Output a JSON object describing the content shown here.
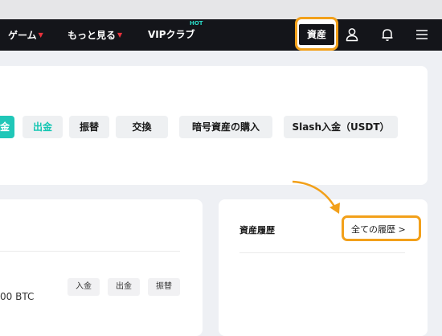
{
  "nav": {
    "games": "ゲーム",
    "more": "もっと見る",
    "vip": "VIPクラブ",
    "hot_badge": "HOT",
    "assets": "資産",
    "icons": [
      "user-icon",
      "bell-icon",
      "menu-icon"
    ]
  },
  "actions": [
    "金",
    "出金",
    "振替",
    "交換",
    "暗号資産の購入",
    "Slash入金（USDT）"
  ],
  "history": {
    "title": "資産履歴",
    "all_link": "全ての履歴 >"
  },
  "balance": {
    "amount": "00 BTC",
    "buttons": [
      "入金",
      "出金",
      "振替"
    ]
  },
  "colors": {
    "nav_bg": "#14151a",
    "accent_teal": "#20c7b8",
    "highlight_orange": "#f2a01a",
    "caret_red": "#e8323c"
  }
}
